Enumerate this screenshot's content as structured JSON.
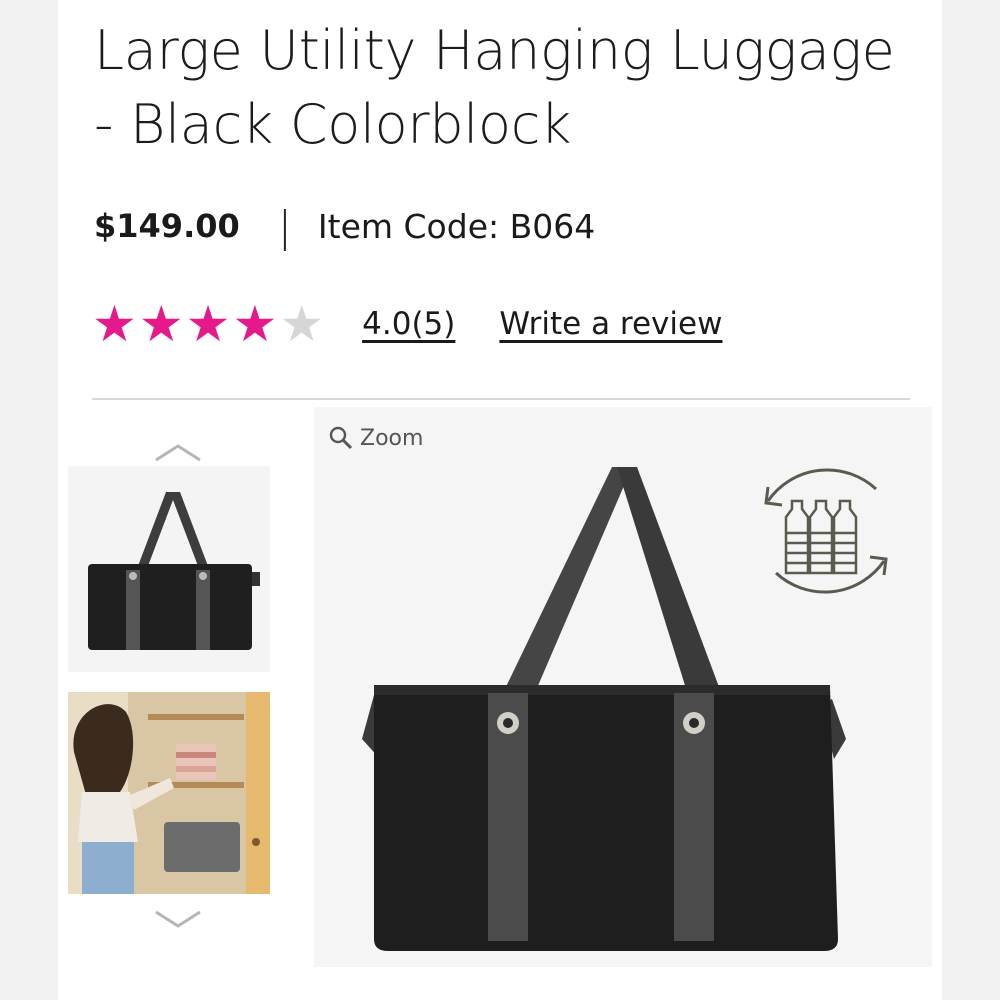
{
  "product": {
    "title_line1": "Large Utility Hanging Luggage",
    "title_line2": "- Black Colorblock",
    "price": "$149.00",
    "separator": "|",
    "item_code": "Item Code: B064",
    "rating": {
      "score": "4.0",
      "count": "(5)",
      "stars_filled": 4,
      "stars_total": 5
    },
    "write_review": "Write a review"
  },
  "gallery": {
    "zoom_label": "Zoom",
    "thumbnails": [
      "bag-product-thumbnail",
      "closet-lifestyle-thumbnail"
    ]
  },
  "icons": {
    "star": "star-icon",
    "search": "magnifier-icon",
    "recycle": "recycled-bottles-icon",
    "chevron_up": "chevron-up-icon",
    "chevron_down": "chevron-down-icon"
  },
  "colors": {
    "star_on": "#e5198c",
    "star_off": "#d6d6d6",
    "bag": "#1d1d1d",
    "strap": "#4a4a4a"
  }
}
